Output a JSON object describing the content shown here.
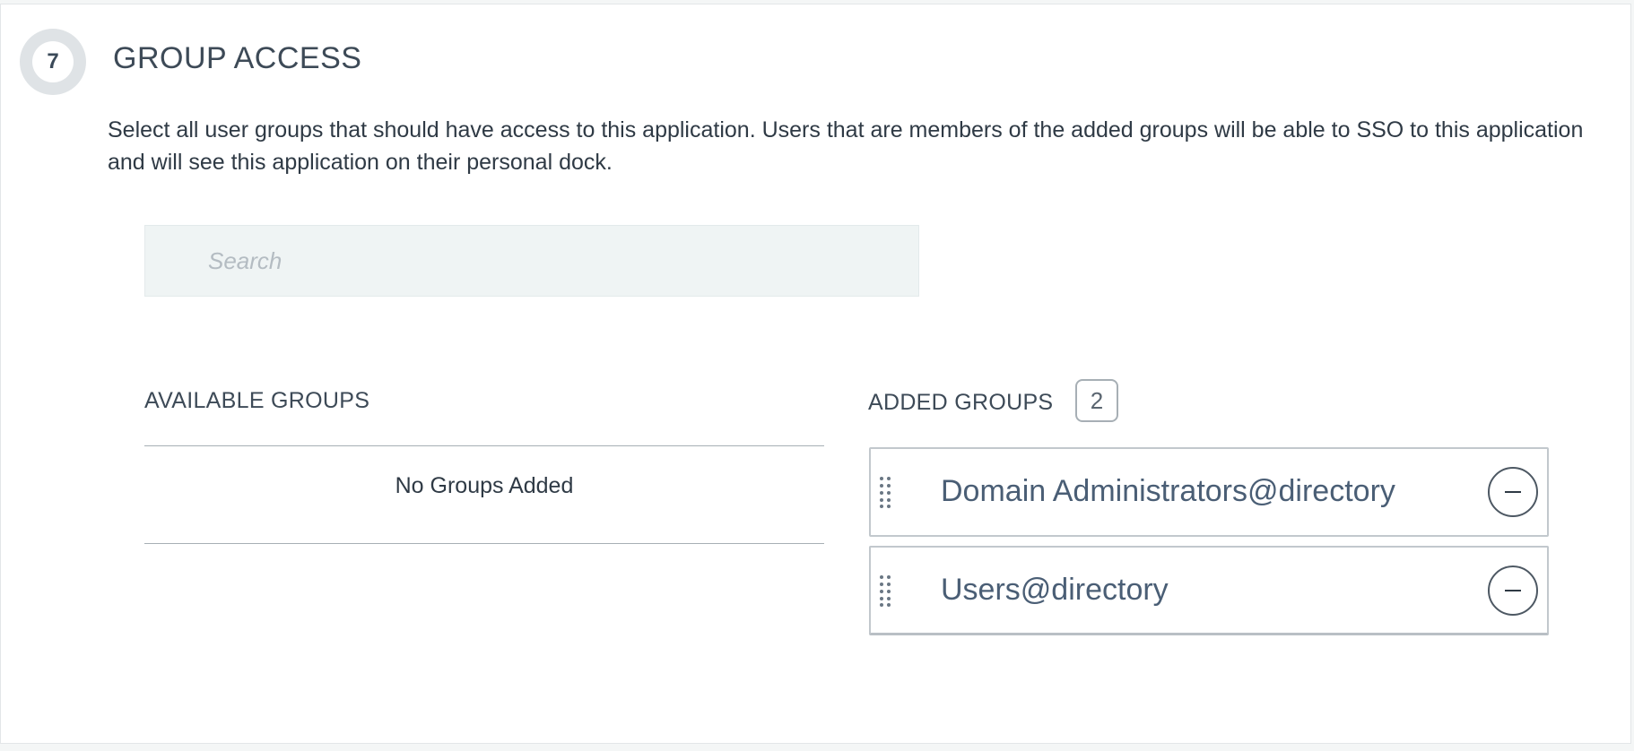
{
  "section": {
    "step_number": "7",
    "title": "GROUP ACCESS",
    "description": "Select all user groups that should have access to this application. Users that are members of the added groups will be able to SSO to this application and will see this application on their personal dock."
  },
  "search": {
    "placeholder": "Search",
    "value": ""
  },
  "available_groups": {
    "label": "AVAILABLE GROUPS",
    "empty_text": "No Groups Added"
  },
  "added_groups": {
    "label": "ADDED GROUPS",
    "count": "2",
    "items": [
      {
        "label": "Domain Administrators@directory",
        "drag_icon": "drag-handle-icon",
        "remove_icon": "minus-icon"
      },
      {
        "label": "Users@directory",
        "drag_icon": "drag-handle-icon",
        "remove_icon": "minus-icon"
      }
    ]
  },
  "colors": {
    "page_background": "#f4f6f6",
    "card_background": "#ffffff",
    "search_background": "#eff4f4",
    "item_text": "#4a5e75",
    "body_text": "#2f3a45",
    "divider": "#a7afb5"
  }
}
